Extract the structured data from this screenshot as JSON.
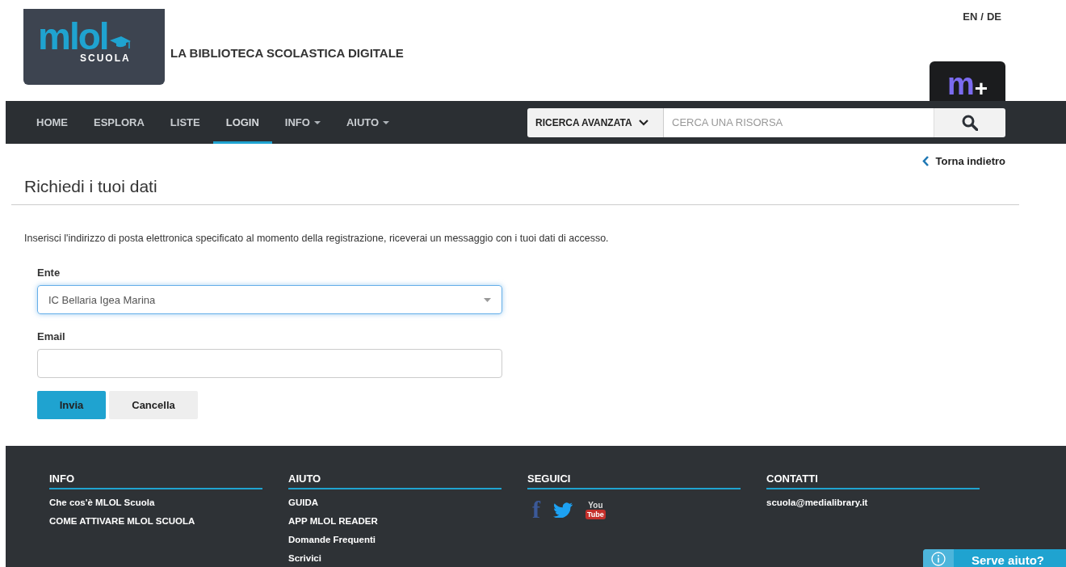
{
  "header": {
    "logo": {
      "word": "mlol",
      "sub": "SCUOLA"
    },
    "tagline": "LA BIBLIOTECA SCOLASTICA DIGITALE",
    "languages": {
      "options": [
        "EN",
        "DE"
      ],
      "separator": "/"
    },
    "plus_tab": {
      "letter": "m",
      "sign": "+"
    }
  },
  "nav": {
    "items": [
      {
        "label": "HOME",
        "selected": false,
        "dropdown": false
      },
      {
        "label": "ESPLORA",
        "selected": false,
        "dropdown": false
      },
      {
        "label": "LISTE",
        "selected": false,
        "dropdown": false
      },
      {
        "label": "LOGIN",
        "selected": true,
        "dropdown": false
      },
      {
        "label": "INFO",
        "selected": false,
        "dropdown": true
      },
      {
        "label": "AIUTO",
        "selected": false,
        "dropdown": true
      }
    ],
    "search": {
      "mode": "RICERCA AVANZATA",
      "placeholder": "CERCA UNA RISORSA"
    }
  },
  "back_link": "Torna indietro",
  "page_title": "Richiedi i tuoi dati",
  "intro": "Inserisci l'indirizzo di posta elettronica specificato al momento della registrazione, riceverai un messaggio con i tuoi dati di accesso.",
  "form": {
    "fields": [
      {
        "kind": "select",
        "label": "Ente",
        "value": "IC Bellaria Igea Marina",
        "focused": true
      },
      {
        "kind": "text",
        "label": "Email",
        "focused": false
      }
    ],
    "buttons": [
      {
        "label": "Invia",
        "kind": "primary"
      },
      {
        "label": "Cancella",
        "kind": "secondary"
      }
    ]
  },
  "footer": {
    "columns": [
      {
        "title": "INFO",
        "links": [
          "Che cos'è MLOL Scuola",
          "COME ATTIVARE MLOL SCUOLA"
        ]
      },
      {
        "title": "AIUTO",
        "links": [
          "GUIDA",
          "APP MLOL READER",
          "Domande Frequenti",
          "Scrivici"
        ]
      },
      {
        "title": "SEGUICI",
        "social": [
          {
            "kind": "facebook",
            "glyph": "f"
          },
          {
            "kind": "twitter"
          },
          {
            "kind": "youtube",
            "top": "You",
            "bottom": "Tube"
          }
        ]
      },
      {
        "title": "CONTATTI",
        "links": [
          "scuola@medialibrary.it"
        ]
      }
    ]
  },
  "help_widget": {
    "label": "Serve aiuto?"
  }
}
